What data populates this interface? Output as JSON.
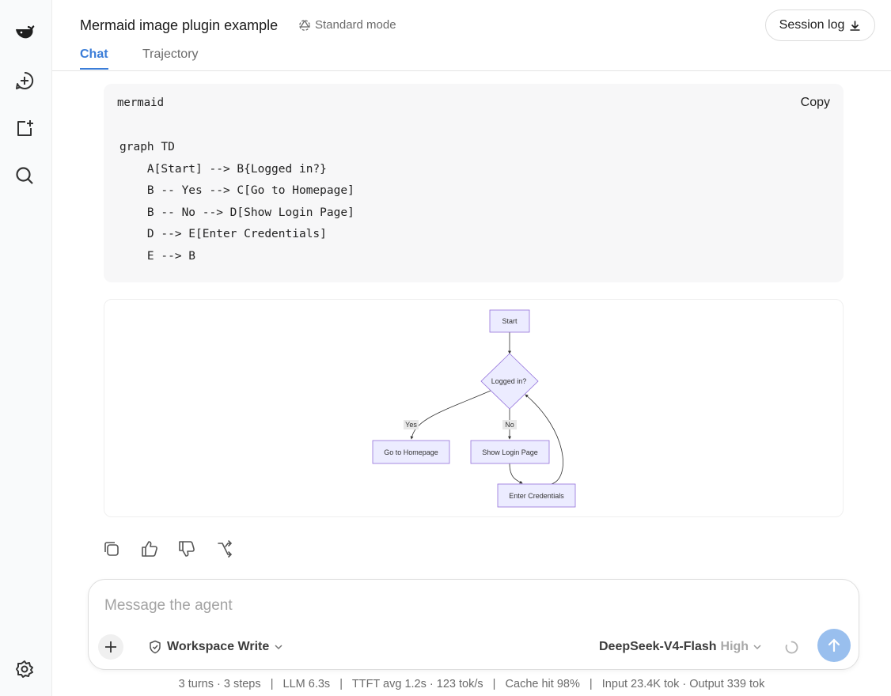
{
  "sidebar": {
    "items": [
      {
        "name": "logo",
        "icon": "whale-logo-icon"
      },
      {
        "name": "new-chat",
        "icon": "plus-circle-icon"
      },
      {
        "name": "new-window",
        "icon": "add-window-icon"
      },
      {
        "name": "search",
        "icon": "search-icon"
      },
      {
        "name": "settings",
        "icon": "gear-icon"
      }
    ]
  },
  "header": {
    "title": "Mermaid image plugin example",
    "mode": "Standard mode",
    "session_log_label": "Session log",
    "tabs": [
      {
        "label": "Chat",
        "active": true
      },
      {
        "label": "Trajectory",
        "active": false
      }
    ]
  },
  "code_block": {
    "language": "mermaid",
    "copy_label": "Copy",
    "lines": [
      "graph TD",
      "    A[Start] --> B{Logged in?}",
      "    B -- Yes --> C[Go to Homepage]",
      "    B -- No --> D[Show Login Page]",
      "    D --> E[Enter Credentials]",
      "    E --> B"
    ]
  },
  "diagram": {
    "nodes": {
      "start": "Start",
      "decision": "Logged in?",
      "homepage": "Go to Homepage",
      "login": "Show Login Page",
      "credentials": "Enter Credentials"
    },
    "edge_labels": {
      "yes": "Yes",
      "no": "No"
    },
    "colors": {
      "node_fill": "#ececff",
      "node_stroke": "#9370db",
      "edge": "#333333"
    }
  },
  "actions": [
    {
      "name": "copy",
      "icon": "copy-icon"
    },
    {
      "name": "like",
      "icon": "thumbs-up-icon"
    },
    {
      "name": "dislike",
      "icon": "thumbs-down-icon"
    },
    {
      "name": "branch",
      "icon": "branch-icon"
    }
  ],
  "composer": {
    "placeholder": "Message the agent",
    "permission": "Workspace Write",
    "model": "DeepSeek-V4-Flash",
    "reasoning": "High"
  },
  "status": "3 turns · 3 steps   |   LLM 6.3s   |   TTFT avg 1.2s · 123 tok/s   |   Cache hit 98%   |   Input 23.4K tok · Output 339 tok",
  "colors": {
    "accent": "#3b7dd8",
    "send_button": "#99bfee"
  }
}
